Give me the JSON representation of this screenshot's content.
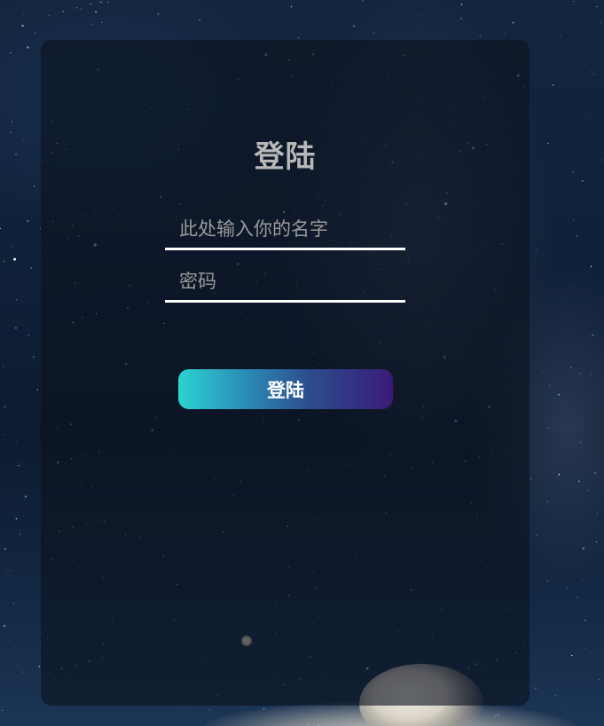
{
  "login": {
    "title": "登陆",
    "username": {
      "value": "",
      "placeholder": "此处输入你的名字"
    },
    "password": {
      "value": "",
      "placeholder": "密码"
    },
    "submit_label": "登陆"
  },
  "colors": {
    "button_gradient_start": "#2bd3d0",
    "button_gradient_end": "#3a1a78",
    "underline": "#ffffff",
    "title": "#b8b8b8"
  }
}
